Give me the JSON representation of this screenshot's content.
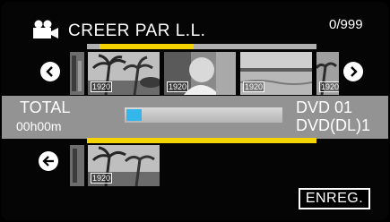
{
  "header": {
    "title": "CREER PAR L.L.",
    "counter": "0/999",
    "icon": "movie-camera-icon"
  },
  "top_progress_fraction": 0.41,
  "thumbnails": [
    {
      "badge": "1920"
    },
    {
      "badge": "1920"
    },
    {
      "badge": "1920"
    },
    {
      "badge": "1920"
    }
  ],
  "info_bar": {
    "total_label": "TOTAL",
    "total_time": "00h00m",
    "capacity_used_fraction": 0.05,
    "disc_line1": "DVD  01",
    "disc_line2": "DVD(DL)1"
  },
  "selected": [
    {
      "badge": "1920"
    }
  ],
  "buttons": {
    "save": "ENREG."
  },
  "icons": {
    "prev": "chevron-left-icon",
    "next": "chevron-right-icon",
    "back": "arrow-left-icon"
  },
  "colors": {
    "accent_yellow": "#f3d400",
    "capacity_blue": "#33b7ea",
    "info_bar_gray": "#939393"
  }
}
